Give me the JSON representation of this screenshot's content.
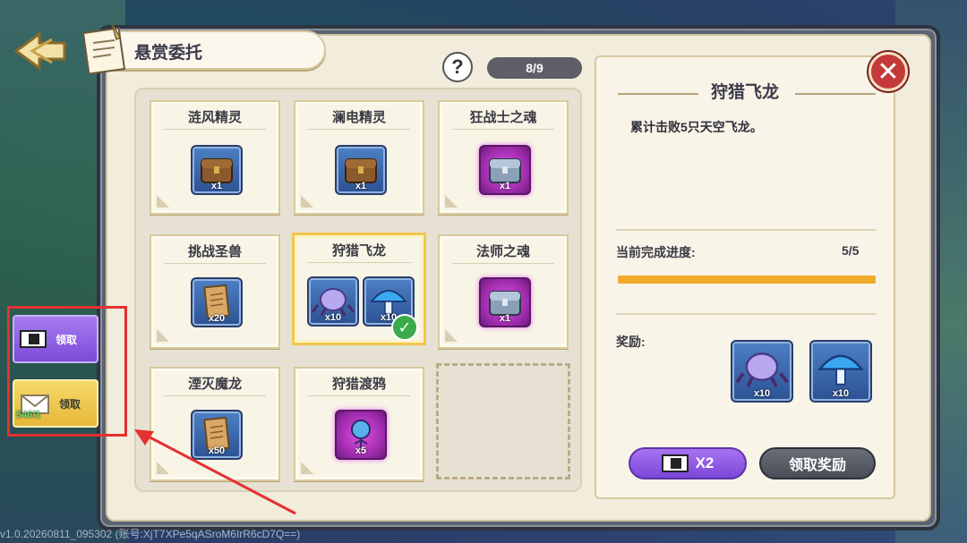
{
  "panel": {
    "title": "悬赏委托",
    "help_label": "?",
    "progress_count": "8/9",
    "close_label": "✕"
  },
  "quests": [
    {
      "name": "涟风精灵",
      "items": [
        {
          "icon": "wooden-chest",
          "qty": "x1"
        }
      ]
    },
    {
      "name": "澜电精灵",
      "items": [
        {
          "icon": "wooden-chest",
          "qty": "x1"
        }
      ]
    },
    {
      "name": "狂战士之魂",
      "items": [
        {
          "icon": "silver-chest",
          "qty": "x1"
        }
      ]
    },
    {
      "name": "挑战圣兽",
      "items": [
        {
          "icon": "parchment-scroll",
          "qty": "x20"
        }
      ]
    },
    {
      "name": "狩猎飞龙",
      "items": [
        {
          "icon": "purple-crystal",
          "qty": "x10"
        },
        {
          "icon": "blue-mushroom",
          "qty": "x10"
        }
      ],
      "selected": true,
      "completed": true
    },
    {
      "name": "法师之魂",
      "items": [
        {
          "icon": "silver-chest",
          "qty": "x1"
        }
      ]
    },
    {
      "name": "湮灭魔龙",
      "items": [
        {
          "icon": "parchment-scroll",
          "qty": "x50"
        }
      ]
    },
    {
      "name": "狩猎渡鸦",
      "items": [
        {
          "icon": "purple-flower",
          "qty": "x5"
        }
      ]
    }
  ],
  "detail": {
    "title": "狩猎飞龙",
    "description": "累计击败5只天空飞龙。",
    "progress_label": "当前完成进度:",
    "progress_value": "5/5",
    "progress_fraction": 1.0,
    "reward_label": "奖励:",
    "rewards": [
      {
        "icon": "purple-crystal",
        "qty": "x10"
      },
      {
        "icon": "blue-mushroom",
        "qty": "x10"
      }
    ],
    "double_button": "X2",
    "claim_button": "领取奖励"
  },
  "side": {
    "video_claim": "领取",
    "mail_claim": "领取",
    "mail_count": "546/1"
  },
  "footer": "v1.0.20260811_095302 (账号:XjT7XPe5qASroM6IrR6cD7Q==)",
  "colors": {
    "progress": "#f0a92a",
    "selected_border": "#f1c64a",
    "purple_button": "#7b47d8",
    "highlight_box": "#e53030"
  }
}
